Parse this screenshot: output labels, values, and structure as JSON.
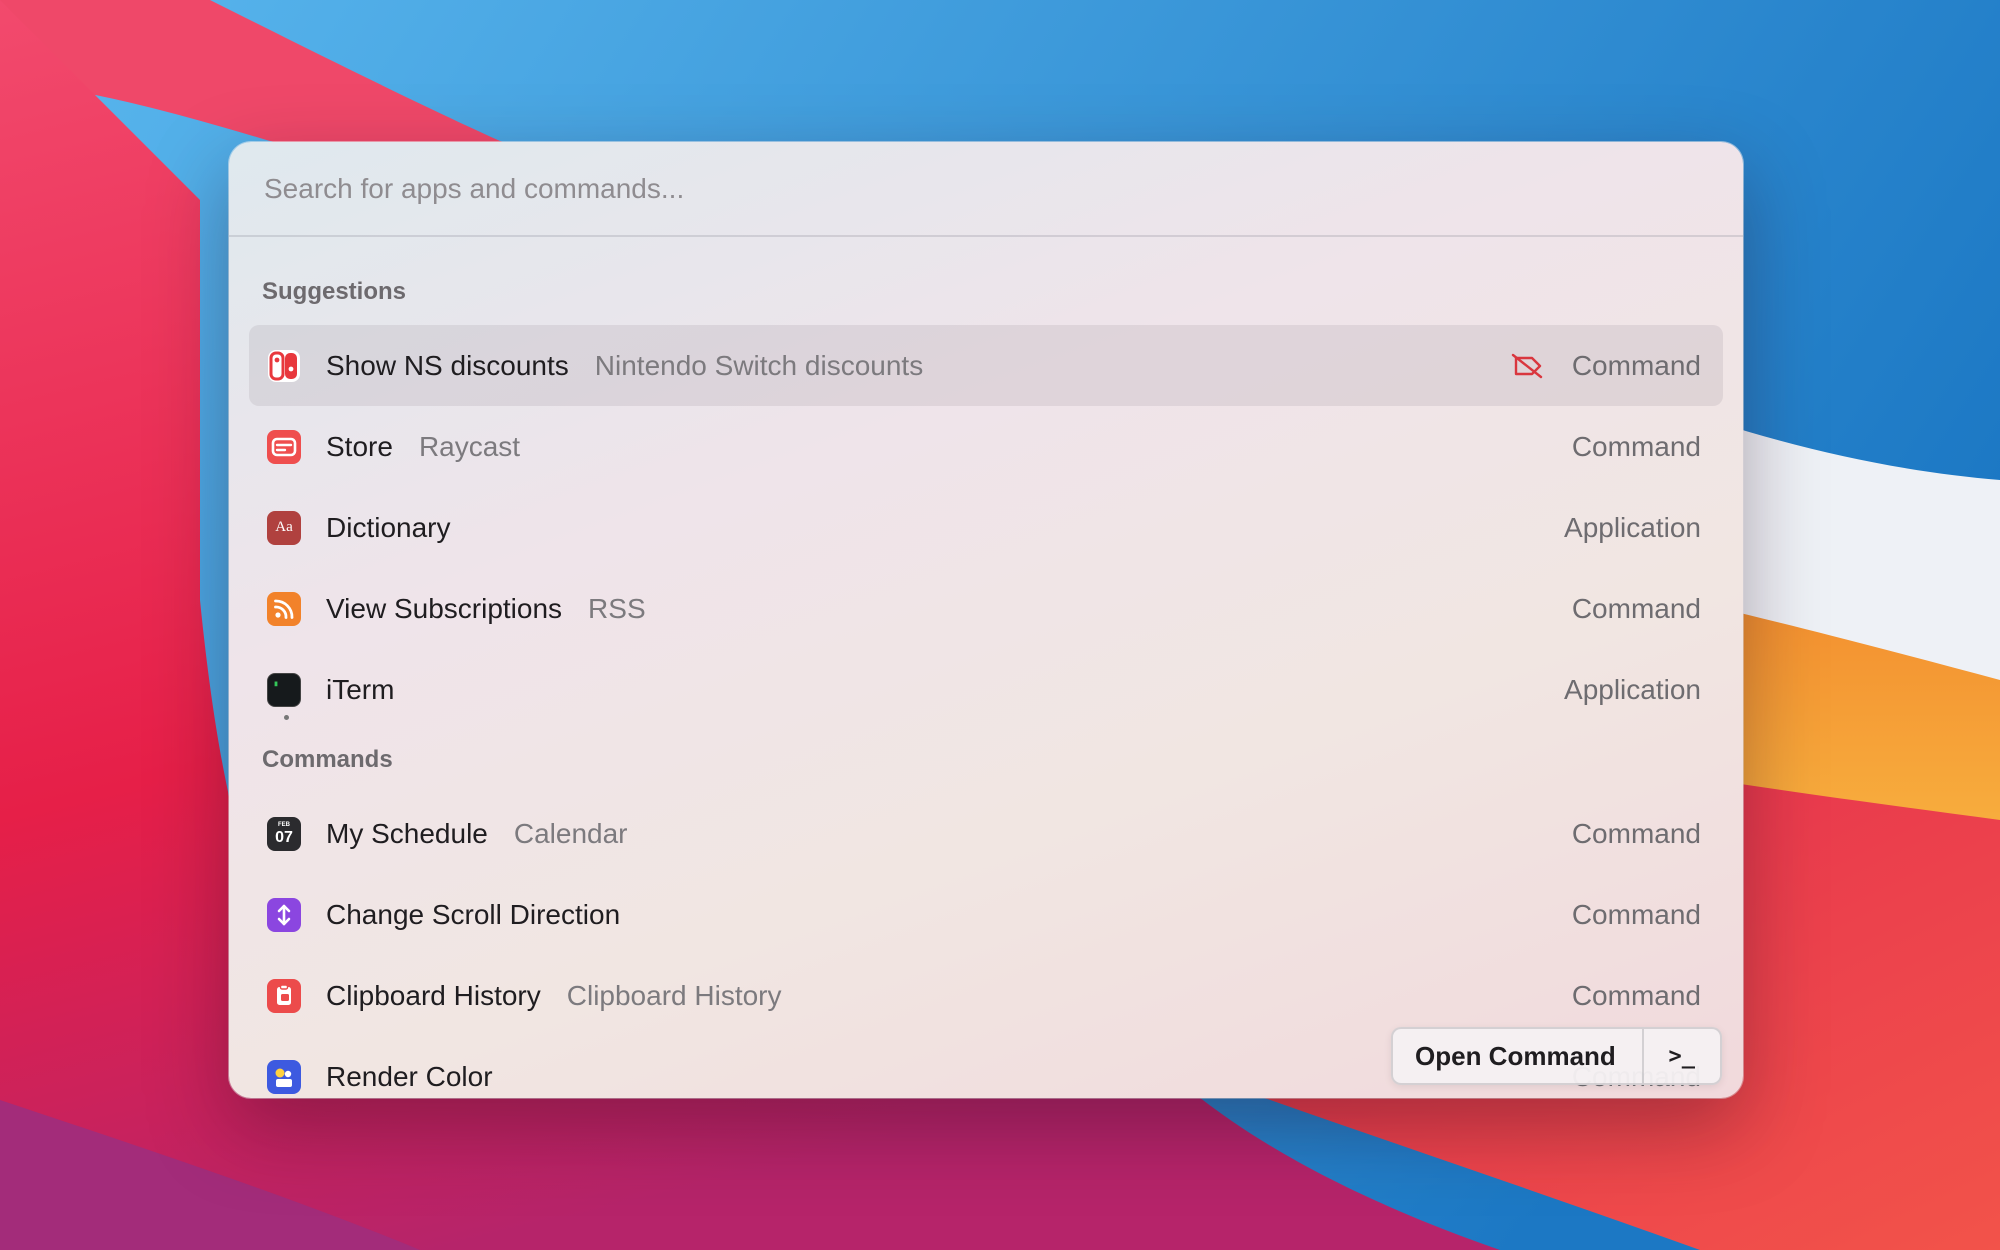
{
  "search": {
    "placeholder": "Search for apps and commands..."
  },
  "sections": [
    {
      "header": "Suggestions",
      "items": [
        {
          "title": "Show NS discounts",
          "subtitle": "Nintendo Switch discounts",
          "type": "Command",
          "icon": "nintendo-switch-icon",
          "selected": true,
          "accessory": "disabled-tag-icon"
        },
        {
          "title": "Store",
          "subtitle": "Raycast",
          "type": "Command",
          "icon": "store-icon"
        },
        {
          "title": "Dictionary",
          "subtitle": "",
          "type": "Application",
          "icon": "dictionary-icon"
        },
        {
          "title": "View Subscriptions",
          "subtitle": "RSS",
          "type": "Command",
          "icon": "rss-icon"
        },
        {
          "title": "iTerm",
          "subtitle": "",
          "type": "Application",
          "icon": "iterm-icon",
          "running": true
        }
      ]
    },
    {
      "header": "Commands",
      "items": [
        {
          "title": "My Schedule",
          "subtitle": "Calendar",
          "type": "Command",
          "icon": "calendar-icon"
        },
        {
          "title": "Change Scroll Direction",
          "subtitle": "",
          "type": "Command",
          "icon": "scroll-direction-icon"
        },
        {
          "title": "Clipboard History",
          "subtitle": "Clipboard History",
          "type": "Command",
          "icon": "clipboard-icon"
        },
        {
          "title": "Render Color",
          "subtitle": "",
          "type": "Command",
          "icon": "color-icon"
        }
      ]
    }
  ],
  "icons": {
    "dictionary_glyph": "Aa",
    "calendar_month": "FEB",
    "calendar_day": "07"
  },
  "action_bar": {
    "primary_label": "Open Command",
    "secondary_label": ">_"
  },
  "colors": {
    "switch_red": "#e8383d",
    "store_red": "#ef4e4e",
    "dictionary_red": "#b0413f",
    "rss_orange": "#f2822a",
    "scroll_purple": "#8b46e0",
    "clipboard_red": "#ec4b4b",
    "color_blue": "#3d5ae0"
  }
}
